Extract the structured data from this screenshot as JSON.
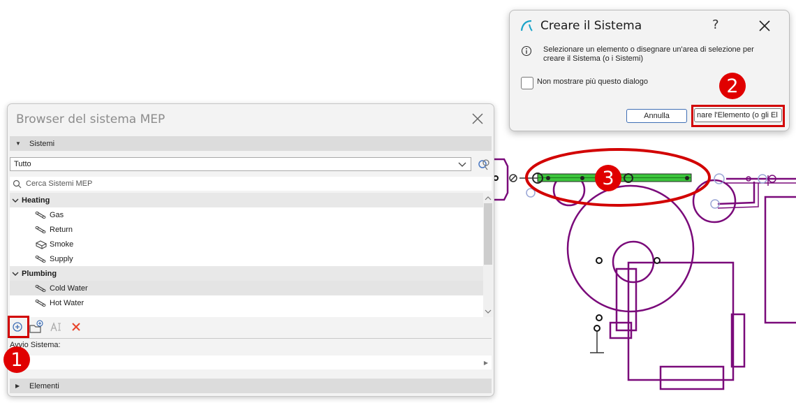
{
  "panel": {
    "title": "Browser del sistema MEP",
    "systems_section": "Sistemi",
    "filter_value": "Tutto",
    "search_placeholder": "Cerca Sistemi MEP",
    "tree": {
      "groups": [
        {
          "label": "Heating",
          "items": [
            {
              "label": "Gas",
              "icon": "pipe-system-icon"
            },
            {
              "label": "Return",
              "icon": "pipe-system-icon"
            },
            {
              "label": "Smoke",
              "icon": "duct-system-icon"
            },
            {
              "label": "Supply",
              "icon": "pipe-system-icon"
            }
          ]
        },
        {
          "label": "Plumbing",
          "items": [
            {
              "label": "Cold Water",
              "icon": "pipe-system-icon",
              "selected": true
            },
            {
              "label": "Hot Water",
              "icon": "pipe-system-icon"
            }
          ]
        }
      ]
    },
    "toolbar": {
      "new_system": "add-system-icon",
      "new_folder": "new-folder-icon",
      "rename": "rename-icon",
      "delete": "delete-icon"
    },
    "field_label": "Avvio Sistema:",
    "elements_section": "Elementi"
  },
  "dialog": {
    "title": "Creare il Sistema",
    "help": "?",
    "message": "Selezionare un elemento o disegnare un'area di selezione per creare il Sistema (o i Sistemi)",
    "checkbox_label": "Non mostrare più questo dialogo",
    "cancel_label": "Annulla",
    "create_label": "nare l'Elemento (o gli El"
  },
  "callouts": {
    "one": "1",
    "two": "2",
    "three": "3"
  },
  "colors": {
    "cad_line": "#7a0a7a",
    "selected_pipe": "#3cc43c",
    "callout_red": "#e00000",
    "accent_blue": "#3f6fb5"
  }
}
